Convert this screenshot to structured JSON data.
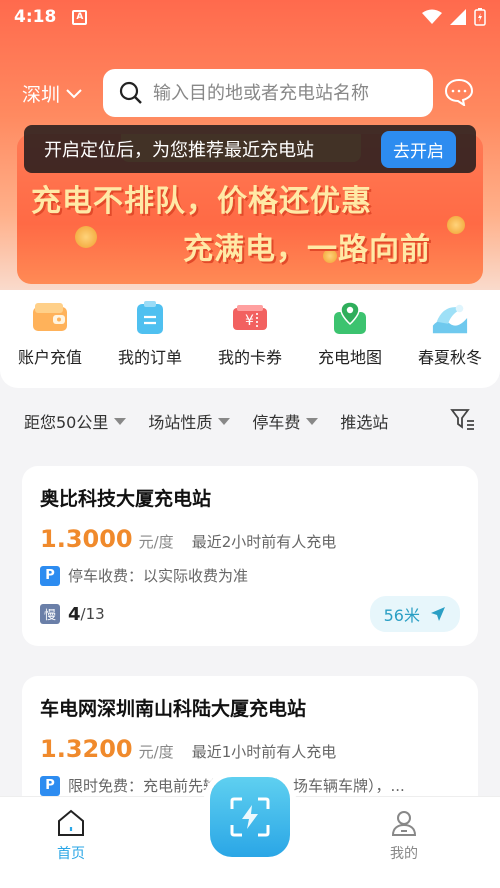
{
  "status_bar": {
    "time": "4:18",
    "app_badge": "A"
  },
  "header": {
    "city": "深圳",
    "search_placeholder": "输入目的地或者充电站名称"
  },
  "banner": {
    "line1": "充电不排队，价格还优惠",
    "line2": "充满电，一路向前"
  },
  "toast": {
    "message": "开启定位后，为您推荐最近充电站",
    "button_label": "去开启"
  },
  "quick_actions": [
    {
      "label": "账户充值",
      "icon": "wallet-icon"
    },
    {
      "label": "我的订单",
      "icon": "order-icon"
    },
    {
      "label": "我的卡券",
      "icon": "coupon-icon"
    },
    {
      "label": "充电地图",
      "icon": "map-icon"
    },
    {
      "label": "春夏秋冬",
      "icon": "season-icon"
    }
  ],
  "filters": [
    {
      "label": "距您50公里",
      "has_dropdown": true
    },
    {
      "label": "场站性质",
      "has_dropdown": true
    },
    {
      "label": "停车费",
      "has_dropdown": true
    },
    {
      "label": "推选站",
      "has_dropdown": false
    }
  ],
  "stations": [
    {
      "name": "奥比科技大厦充电站",
      "price": "1.3000",
      "unit": "元/度",
      "recent": "最近2小时前有人充电",
      "parking_badge": "P",
      "parking": "停车收费：以实际收费为准",
      "slow_badge": "慢",
      "slow_available": "4",
      "slow_total": "/13",
      "distance": "56米"
    },
    {
      "name": "车电网深圳南山科陆大厦充电站",
      "price": "1.3200",
      "unit": "元/度",
      "recent": "最近1小时前有人充电",
      "parking_badge": "P",
      "parking": "限时免费：充电前先输入车牌（入场车辆车牌），..."
    }
  ],
  "bottom_nav": {
    "home_label": "首页",
    "mine_label": "我的"
  },
  "colors": {
    "primary": "#ff6a4d",
    "price": "#f08a2c",
    "accent_blue": "#2d8cf0",
    "scan": "#2aa6e6"
  }
}
